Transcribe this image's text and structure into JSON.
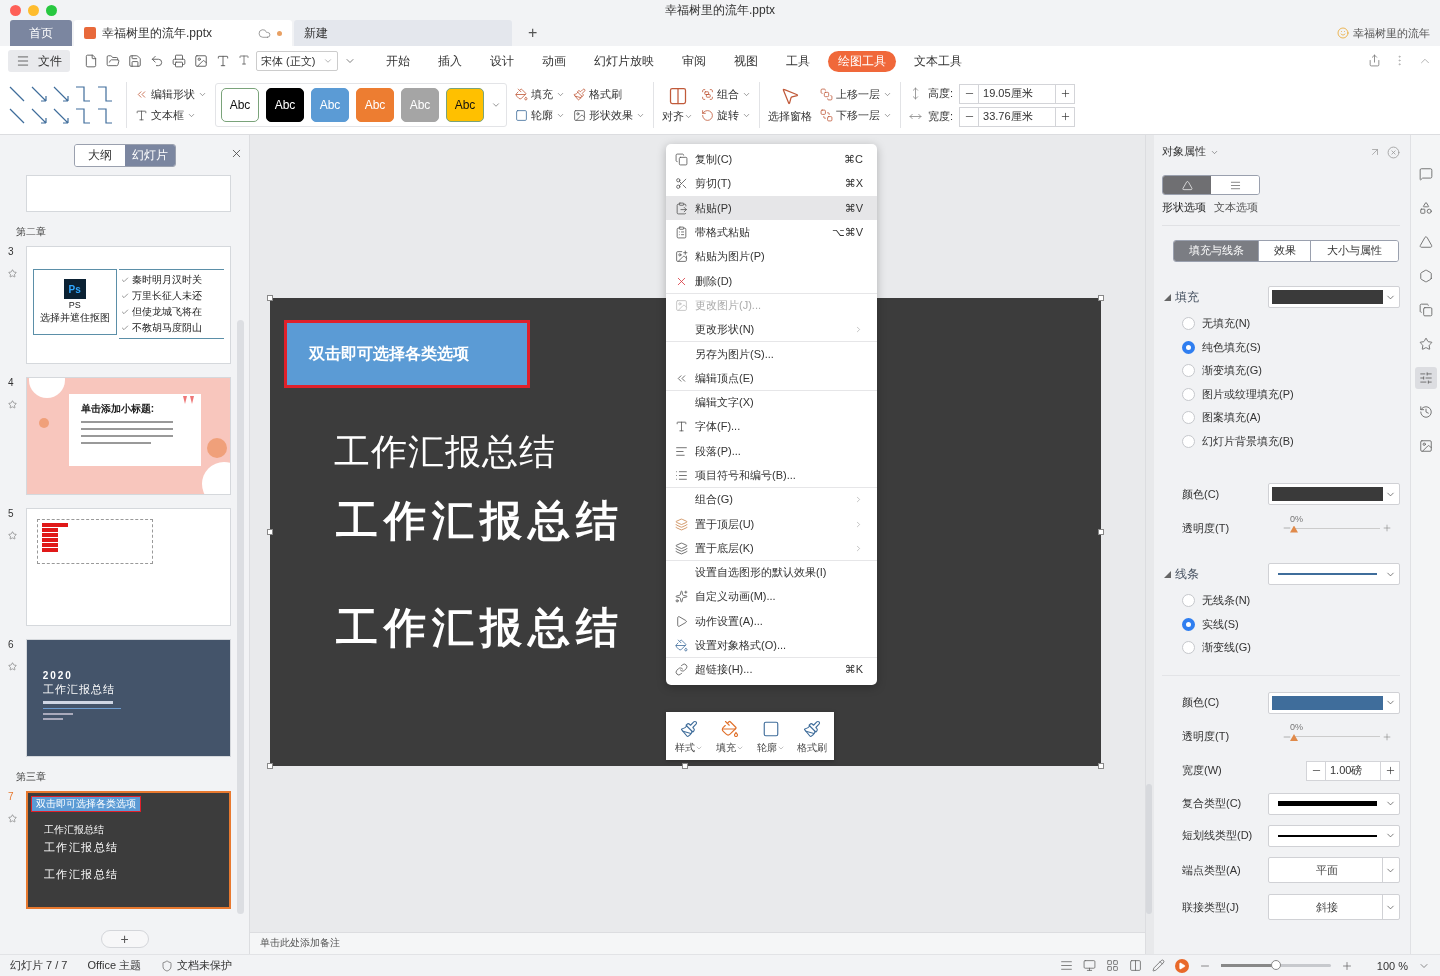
{
  "window": {
    "title": "幸福树里的流年.pptx"
  },
  "doc_tabs": [
    {
      "label": "首页",
      "kind": "home",
      "selected": false,
      "unsaved": false
    },
    {
      "label": "幸福树里的流年.pptx",
      "kind": "document",
      "selected": true,
      "unsaved": true
    },
    {
      "label": "新建",
      "kind": "new",
      "selected": false,
      "unsaved": false
    }
  ],
  "new_tab": "+",
  "account": "幸福树里的流年",
  "file_button": "文件",
  "font_select": "宋体 (正文)",
  "menu_tabs": [
    {
      "label": "开始",
      "selected": false
    },
    {
      "label": "插入",
      "selected": false
    },
    {
      "label": "设计",
      "selected": false
    },
    {
      "label": "动画",
      "selected": false
    },
    {
      "label": "幻灯片放映",
      "selected": false
    },
    {
      "label": "审阅",
      "selected": false
    },
    {
      "label": "视图",
      "selected": false
    },
    {
      "label": "工具",
      "selected": false
    },
    {
      "label": "绘图工具",
      "selected": true
    },
    {
      "label": "文本工具",
      "selected": false
    }
  ],
  "ribbon": {
    "edit_shape": "编辑形状",
    "text_box": "文本框",
    "styles": [
      {
        "label": "Abc",
        "color": "#ffffff"
      },
      {
        "label": "Abc",
        "color": "#000000"
      },
      {
        "label": "Abc",
        "color": "#5b9bd5"
      },
      {
        "label": "Abc",
        "color": "#ed7d31"
      },
      {
        "label": "Abc",
        "color": "#a5a5a5"
      },
      {
        "label": "Abc",
        "color": "#ffc000"
      }
    ],
    "fill": "填充",
    "outline": "轮廓",
    "format_painter": "格式刷",
    "shape_effect": "形状效果",
    "align": "对齐",
    "group": "组合",
    "rotate": "旋转",
    "selection_pane": "选择窗格",
    "bring_forward": "上移一层",
    "send_backward": "下移一层",
    "sizes": [
      {
        "label": "高度:",
        "value": "19.05厘米"
      },
      {
        "label": "宽度:",
        "value": "33.76厘米"
      }
    ]
  },
  "panel_tabs": [
    {
      "label": "大纲",
      "selected": false
    },
    {
      "label": "幻灯片",
      "selected": true
    }
  ],
  "thumbnails": [
    {
      "kind": "blank",
      "partial": true,
      "selected": false
    },
    {
      "kind": "section",
      "label": "第二章"
    },
    {
      "kind": "ps",
      "number": "3",
      "partial": false,
      "selected": false,
      "logo": "Ps",
      "title": "PS",
      "caption": "选择并遮住抠图",
      "bullets": [
        "秦时明月汉时关",
        "万里长征人未还",
        "但使龙城飞将在",
        "不教胡马度阴山"
      ]
    },
    {
      "kind": "quote",
      "number": "4",
      "partial": false,
      "selected": false,
      "title": "单击添加小标题:"
    },
    {
      "kind": "red",
      "number": "5",
      "partial": false,
      "selected": false
    },
    {
      "kind": "cover",
      "number": "6",
      "partial": false,
      "selected": false,
      "year": "2020",
      "title": "工作汇报总结"
    },
    {
      "kind": "section",
      "label": "第三章"
    },
    {
      "kind": "current",
      "number": "7",
      "partial": false,
      "selected": true,
      "button_text": "双击即可选择各类选项",
      "lines": [
        "工作汇报总结",
        "工作汇报总结",
        "工作汇报总结"
      ]
    }
  ],
  "add_slide": "+",
  "slide": {
    "button_text": "双击即可选择各类选项",
    "lines": [
      "工作汇报总结",
      "工作汇报总结",
      "工作汇报总结"
    ]
  },
  "context_menu": [
    {
      "label": "复制(C)",
      "shortcut": "⌘C",
      "highlighted": false,
      "disabled": false,
      "submenu": false,
      "divider": false
    },
    {
      "label": "剪切(T)",
      "shortcut": "⌘X",
      "highlighted": false,
      "disabled": false,
      "submenu": false,
      "divider": false
    },
    {
      "label": "粘贴(P)",
      "shortcut": "⌘V",
      "highlighted": true,
      "disabled": false,
      "submenu": false,
      "divider": false
    },
    {
      "label": "带格式粘贴",
      "shortcut": "⌥⌘V",
      "highlighted": false,
      "disabled": false,
      "submenu": false,
      "divider": false
    },
    {
      "label": "粘贴为图片(P)",
      "highlighted": false,
      "disabled": false,
      "submenu": false,
      "divider": false
    },
    {
      "label": "删除(D)",
      "highlighted": false,
      "disabled": false,
      "submenu": false,
      "divider": false
    },
    {
      "label": "更改图片(J)...",
      "highlighted": false,
      "disabled": true,
      "submenu": false,
      "divider": true
    },
    {
      "label": "更改形状(N)",
      "highlighted": false,
      "disabled": false,
      "submenu": true,
      "divider": false
    },
    {
      "label": "另存为图片(S)...",
      "highlighted": false,
      "disabled": false,
      "submenu": false,
      "divider": true
    },
    {
      "label": "编辑顶点(E)",
      "highlighted": false,
      "disabled": false,
      "submenu": false,
      "divider": false
    },
    {
      "label": "编辑文字(X)",
      "highlighted": false,
      "disabled": false,
      "submenu": false,
      "divider": true
    },
    {
      "label": "字体(F)...",
      "highlighted": false,
      "disabled": false,
      "submenu": false,
      "divider": false
    },
    {
      "label": "段落(P)...",
      "highlighted": false,
      "disabled": false,
      "submenu": false,
      "divider": false
    },
    {
      "label": "项目符号和编号(B)...",
      "highlighted": false,
      "disabled": false,
      "submenu": false,
      "divider": false
    },
    {
      "label": "组合(G)",
      "highlighted": false,
      "disabled": false,
      "submenu": true,
      "divider": true
    },
    {
      "label": "置于顶层(U)",
      "highlighted": false,
      "disabled": false,
      "submenu": true,
      "divider": false
    },
    {
      "label": "置于底层(K)",
      "highlighted": false,
      "disabled": false,
      "submenu": true,
      "divider": false
    },
    {
      "label": "设置自选图形的默认效果(I)",
      "highlighted": false,
      "disabled": false,
      "submenu": false,
      "divider": true
    },
    {
      "label": "自定义动画(M)...",
      "highlighted": false,
      "disabled": false,
      "submenu": false,
      "divider": false
    },
    {
      "label": "动作设置(A)...",
      "highlighted": false,
      "disabled": false,
      "submenu": false,
      "divider": false
    },
    {
      "label": "设置对象格式(O)...",
      "highlighted": false,
      "disabled": false,
      "submenu": false,
      "divider": false
    },
    {
      "label": "超链接(H)...",
      "shortcut": "⌘K",
      "highlighted": false,
      "disabled": false,
      "submenu": false,
      "divider": true
    }
  ],
  "mini_toolbar": [
    {
      "label": "样式",
      "dropdown": true
    },
    {
      "label": "填充",
      "dropdown": true
    },
    {
      "label": "轮廓",
      "dropdown": true
    },
    {
      "label": "格式刷",
      "dropdown": false
    }
  ],
  "notes_placeholder": "单击此处添加备注",
  "properties": {
    "title": "对象属性",
    "option_tabs": [
      {
        "label": "形状选项",
        "selected": true
      },
      {
        "label": "文本选项",
        "selected": false
      }
    ],
    "sub_tabs": [
      {
        "label": "填充与线条",
        "selected": true
      },
      {
        "label": "效果",
        "selected": false
      },
      {
        "label": "大小与属性",
        "selected": false
      }
    ],
    "sections": [
      {
        "title": "填充",
        "expanded": true,
        "preview": {
          "kind": "color",
          "color": "#3a3a3a"
        },
        "options": [
          {
            "label": "无填充(N)",
            "selected": false
          },
          {
            "label": "纯色填充(S)",
            "selected": true
          },
          {
            "label": "渐变填充(G)",
            "selected": false
          },
          {
            "label": "图片或纹理填充(P)",
            "selected": false
          },
          {
            "label": "图案填充(A)",
            "selected": false
          },
          {
            "label": "幻灯片背景填充(B)",
            "selected": false
          }
        ],
        "rows": [
          {
            "kind": "color",
            "label": "颜色(C)",
            "color": "#3a3a3a"
          },
          {
            "kind": "slider",
            "label": "透明度(T)",
            "reading": "0%",
            "level": 0
          }
        ]
      },
      {
        "title": "线条",
        "expanded": true,
        "preview": {
          "kind": "line",
          "color": "#3f6d9b"
        },
        "options": [
          {
            "label": "无线条(N)",
            "selected": false
          },
          {
            "label": "实线(S)",
            "selected": true
          },
          {
            "label": "渐变线(G)",
            "selected": false
          }
        ],
        "rows": [
          {
            "kind": "color",
            "label": "颜色(C)",
            "color": "#3f6d9b"
          },
          {
            "kind": "slider",
            "label": "透明度(T)",
            "reading": "0%",
            "level": 0
          },
          {
            "kind": "spin",
            "label": "宽度(W)",
            "value": "1.00磅"
          },
          {
            "kind": "line",
            "label": "复合类型(C)",
            "thick": true
          },
          {
            "kind": "line",
            "label": "短划线类型(D)",
            "thick": false
          },
          {
            "kind": "select",
            "label": "端点类型(A)",
            "value": "平面"
          },
          {
            "kind": "select",
            "label": "联接类型(J)",
            "value": "斜接"
          }
        ]
      }
    ]
  },
  "tool_strip": [
    {
      "selected": false
    },
    {
      "selected": false
    },
    {
      "selected": false
    },
    {
      "selected": false
    },
    {
      "selected": false
    },
    {
      "selected": false
    },
    {
      "selected": true
    },
    {
      "selected": false
    },
    {
      "selected": false
    }
  ],
  "status_bar": {
    "slide_count": "幻灯片 7 / 7",
    "theme": "Office 主题",
    "protection": "文档未保护",
    "zoom": "100 %",
    "zoom_slider": {
      "level": 0.5
    }
  }
}
